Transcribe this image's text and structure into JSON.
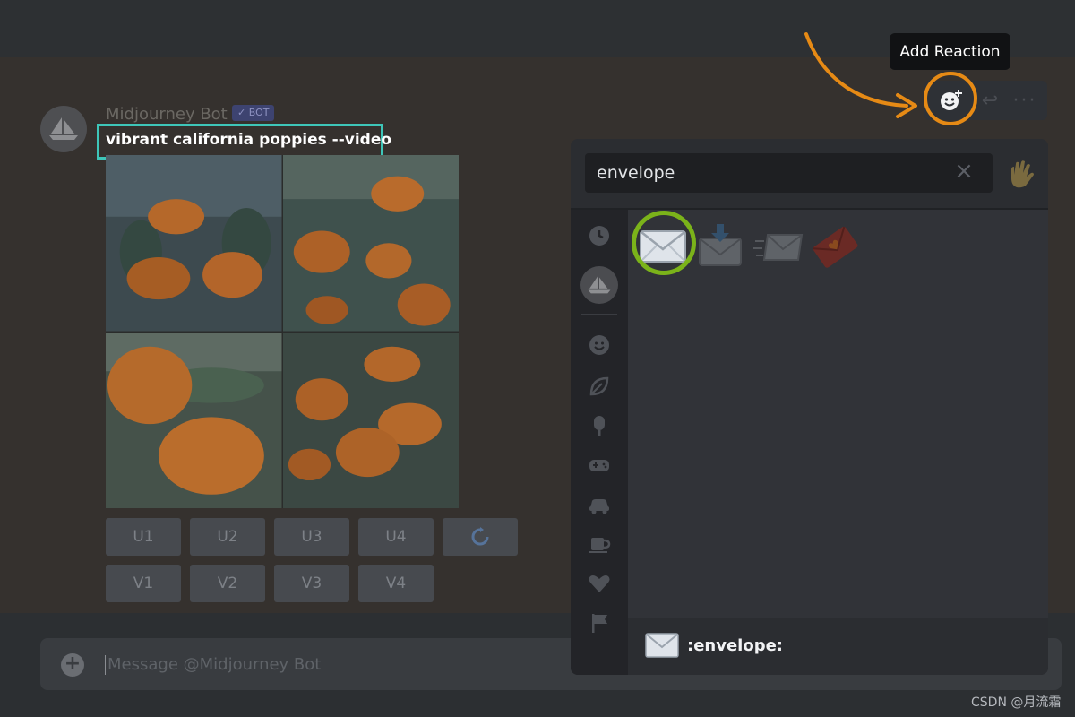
{
  "message": {
    "username": "Midjourney Bot",
    "bot_badge": "✓ BOT",
    "prompt": "vibrant california poppies --video"
  },
  "upscale_buttons": [
    "U1",
    "U2",
    "U3",
    "U4"
  ],
  "variation_buttons": [
    "V1",
    "V2",
    "V3",
    "V4"
  ],
  "reroll_icon": "refresh-icon",
  "composer": {
    "placeholder": "Message @Midjourney Bot"
  },
  "toolbar": {
    "tooltip": "Add Reaction",
    "add_reaction_icon": "add-reaction-icon",
    "reply_icon": "reply-icon",
    "more_icon": "more-icon"
  },
  "emoji_picker": {
    "search_value": "envelope",
    "results": [
      "envelope",
      "envelope-with-arrow",
      "incoming-envelope",
      "love-letter"
    ],
    "selected_name": ":envelope:",
    "categories": [
      "recent",
      "midjourney-server",
      "people",
      "nature",
      "food",
      "activities",
      "travel",
      "objects",
      "symbols",
      "flags"
    ]
  },
  "colors": {
    "highlight_prompt": "#3ec6b9",
    "highlight_add_reaction": "#e68a15",
    "highlight_emoji": "#7bb31a"
  },
  "watermark": "CSDN @月流霜"
}
